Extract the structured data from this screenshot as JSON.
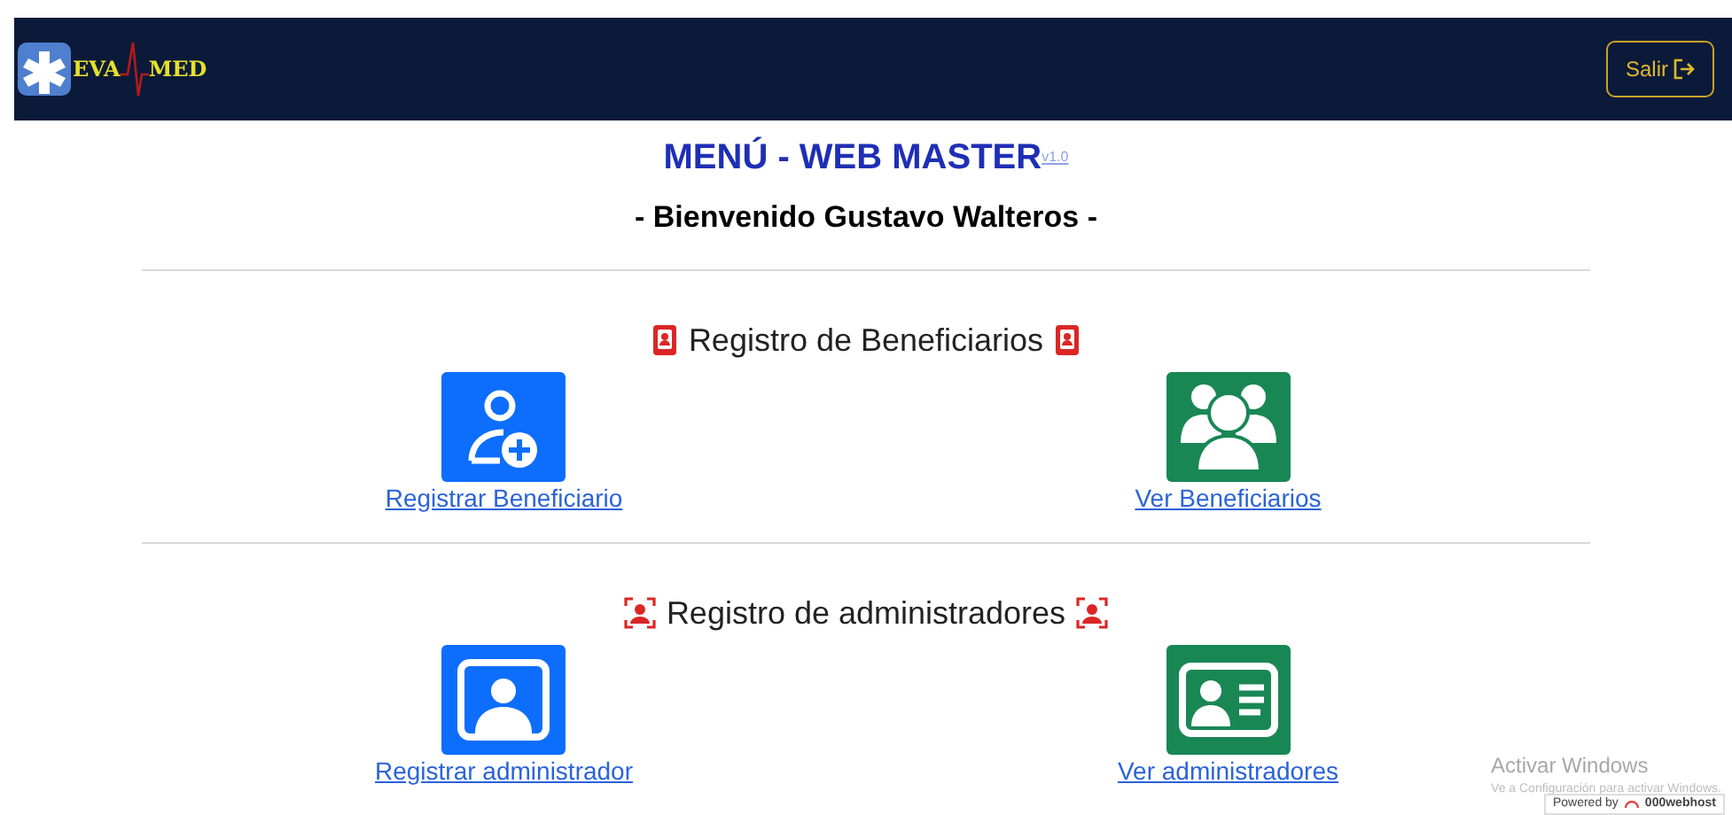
{
  "navbar": {
    "logo_left": "EVA",
    "logo_right": "MED",
    "logout_button": "Salir"
  },
  "title": {
    "text": "MENÚ - WEB MASTER",
    "version": "v1.0"
  },
  "welcome": "- Bienvenido Gustavo Walteros -",
  "sections": [
    {
      "heading": "Registro de Beneficiarios",
      "actions": [
        {
          "label": "Registrar Beneficiario"
        },
        {
          "label": "Ver Beneficiarios"
        }
      ]
    },
    {
      "heading": "Registro de administradores",
      "actions": [
        {
          "label": "Registrar administrador"
        },
        {
          "label": "Ver administradores"
        }
      ]
    }
  ],
  "os_notice": {
    "title": "Activar Windows",
    "text": "Ve a Configuración para activar Windows."
  },
  "host_badge": {
    "prefix": "Powered by",
    "brand": "000webhost"
  }
}
